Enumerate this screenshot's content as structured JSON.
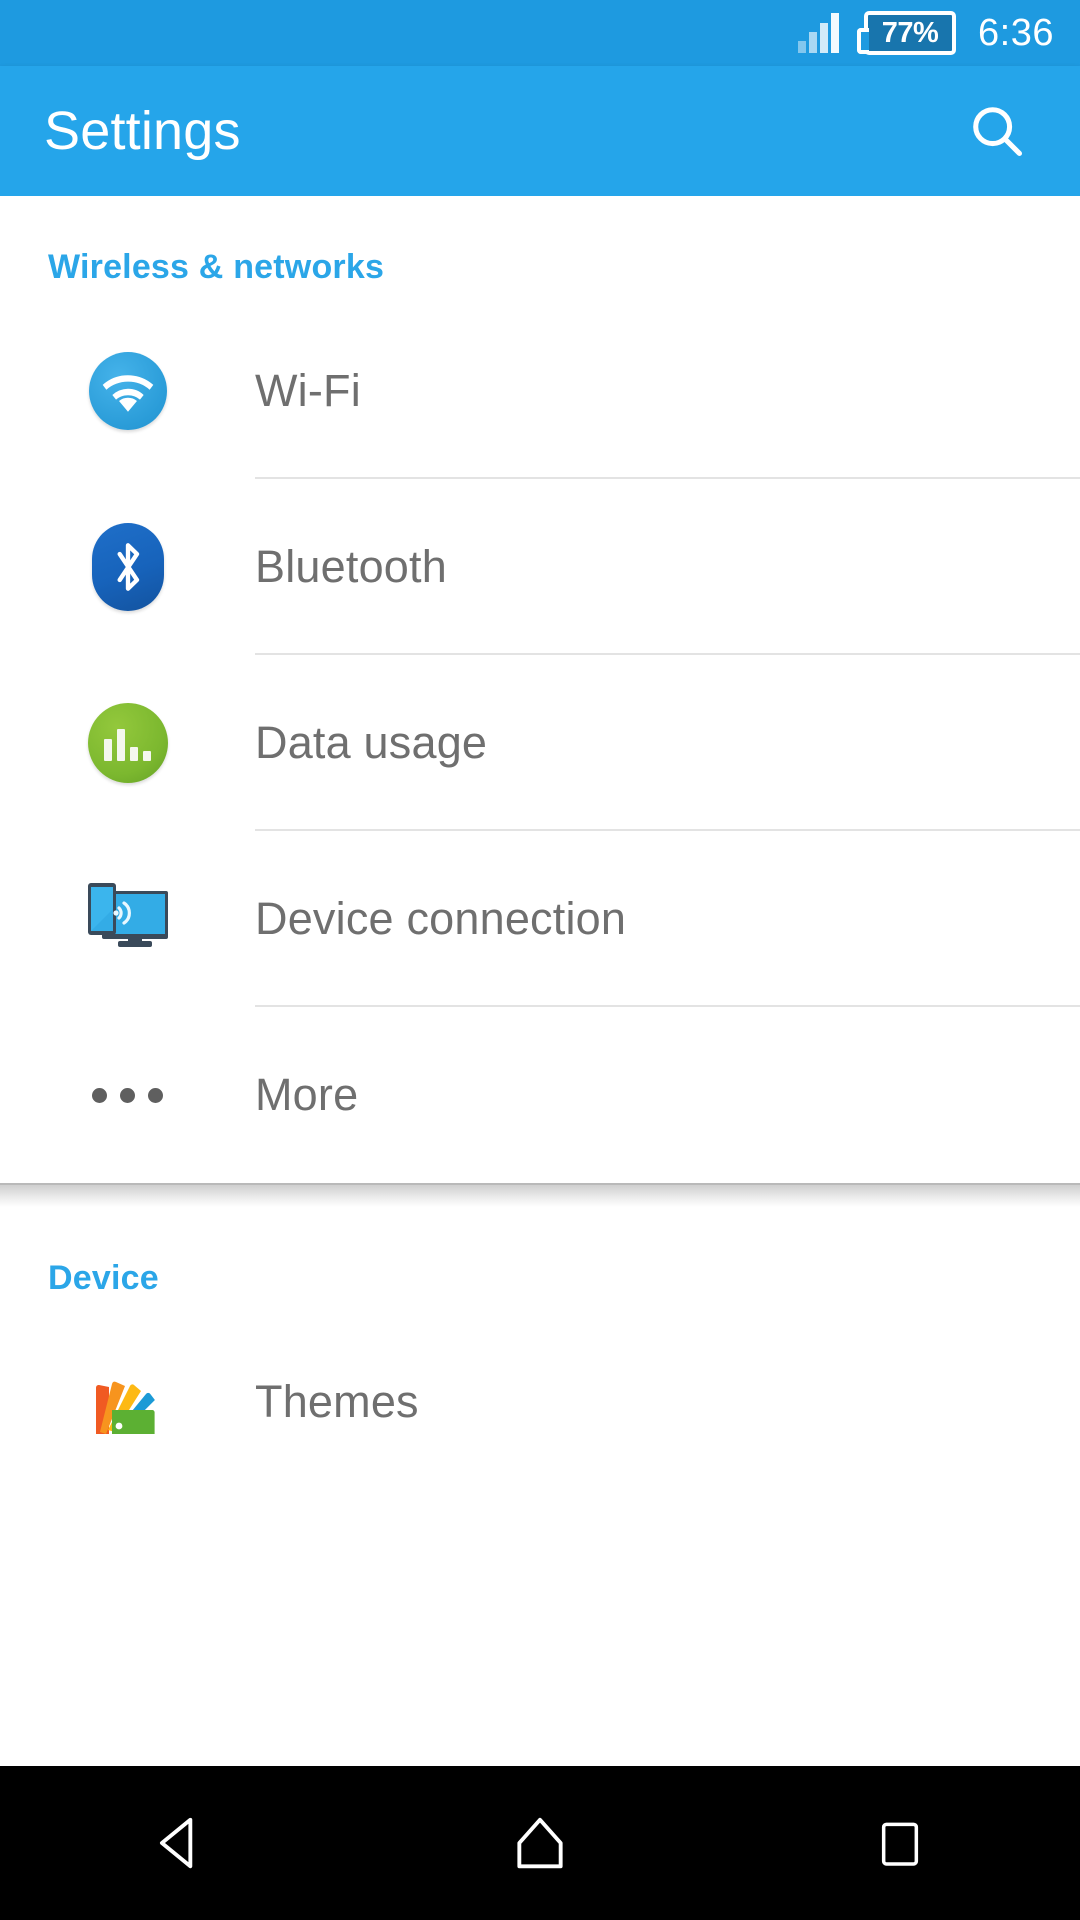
{
  "status_bar": {
    "signal_icon": "signal-bars-icon",
    "battery_icon": "battery-icon",
    "battery_percent": "77%",
    "time": "6:36"
  },
  "app_bar": {
    "title": "Settings",
    "search_icon": "search-icon"
  },
  "sections": [
    {
      "title": "Wireless & networks",
      "items": [
        {
          "label": "Wi-Fi",
          "icon": "wifi-icon"
        },
        {
          "label": "Bluetooth",
          "icon": "bluetooth-icon"
        },
        {
          "label": "Data usage",
          "icon": "data-usage-icon"
        },
        {
          "label": "Device connection",
          "icon": "device-connection-icon"
        },
        {
          "label": "More",
          "icon": "more-icon"
        }
      ]
    },
    {
      "title": "Device",
      "items": [
        {
          "label": "Themes",
          "icon": "themes-icon"
        }
      ]
    }
  ],
  "nav_bar": {
    "back": "back-icon",
    "home": "home-icon",
    "recents": "recents-icon"
  },
  "colors": {
    "status_bar": "#1E9AE0",
    "app_bar": "#25A5EA",
    "accent": "#2BA6E8",
    "label_text": "#6f6f6f",
    "divider": "#e3e3e3",
    "nav_bar": "#000000"
  }
}
